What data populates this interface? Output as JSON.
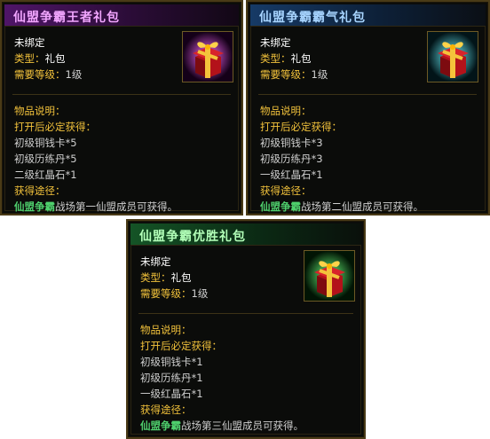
{
  "cards": [
    {
      "title": "仙盟争霸王者礼包",
      "accent": "#5d1b7a",
      "title_color": "#f09cff",
      "glow": "#e033ff",
      "binding": "未绑定",
      "type_label": "类型：",
      "type_value": "礼包",
      "level_label": "需要等级：",
      "level_value": "1级",
      "desc_header": "物品说明：",
      "open_header": "打开后必定获得：",
      "rewards": [
        "初级铜钱卡*5",
        "初级历练丹*5",
        "二级红晶石*1"
      ],
      "source_label": "获得途径：",
      "source_highlight": "仙盟争霸",
      "source_text": "战场第一仙盟成员可获得。"
    },
    {
      "title": "仙盟争霸霸气礼包",
      "accent": "#173b67",
      "title_color": "#9fd0ff",
      "glow": "#22e8ff",
      "binding": "未绑定",
      "type_label": "类型：",
      "type_value": "礼包",
      "level_label": "需要等级：",
      "level_value": "1级",
      "desc_header": "物品说明：",
      "open_header": "打开后必定获得：",
      "rewards": [
        "初级铜钱卡*3",
        "初级历练丹*3",
        "一级红晶石*1"
      ],
      "source_label": "获得途径：",
      "source_highlight": "仙盟争霸",
      "source_text": "战场第二仙盟成员可获得。"
    },
    {
      "title": "仙盟争霸优胜礼包",
      "accent": "#14522b",
      "title_color": "#a8ffb0",
      "glow": "#22ff55",
      "binding": "未绑定",
      "type_label": "类型：",
      "type_value": "礼包",
      "level_label": "需要等级：",
      "level_value": "1级",
      "desc_header": "物品说明：",
      "open_header": "打开后必定获得：",
      "rewards": [
        "初级铜钱卡*1",
        "初级历练丹*1",
        "一级红晶石*1"
      ],
      "source_label": "获得途径：",
      "source_highlight": "仙盟争霸",
      "source_text": "战场第三仙盟成员可获得。"
    }
  ],
  "icon": "gift-box-icon"
}
